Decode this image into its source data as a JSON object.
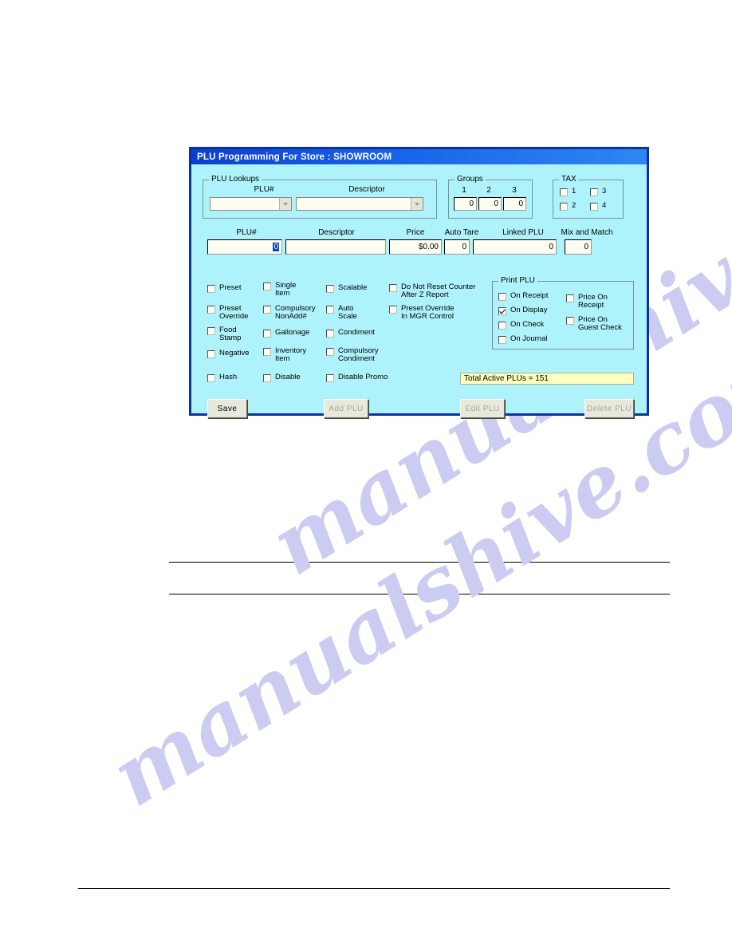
{
  "watermark": {
    "text": "manualshive.com"
  },
  "dialog": {
    "title": "PLU Programming For Store :  SHOWROOM",
    "lookups": {
      "group_title": "PLU Lookups",
      "plu_label": "PLU#",
      "plu_value": "",
      "descriptor_label": "Descriptor",
      "descriptor_value": ""
    },
    "groups": {
      "group_title": "Groups",
      "headers": [
        "1",
        "2",
        "3"
      ],
      "values": [
        "0",
        "0",
        "0"
      ]
    },
    "tax": {
      "group_title": "TAX",
      "items": [
        {
          "label": "1",
          "checked": false
        },
        {
          "label": "3",
          "checked": false
        },
        {
          "label": "2",
          "checked": false
        },
        {
          "label": "4",
          "checked": false
        }
      ]
    },
    "fields": {
      "plu_label": "PLU#",
      "plu_value": "0",
      "descriptor_label": "Descriptor",
      "descriptor_value": "",
      "price_label": "Price",
      "price_value": "$0.00",
      "auto_tare_label": "Auto Tare",
      "auto_tare_value": "0",
      "linked_plu_label": "Linked PLU",
      "linked_plu_value": "0",
      "mix_match_label": "Mix and Match",
      "mix_match_value": "0"
    },
    "options_col1": [
      {
        "label": "Preset",
        "checked": false
      },
      {
        "label": "Preset\nOverride",
        "checked": false
      },
      {
        "label": "Food\nStamp",
        "checked": false
      },
      {
        "label": "Negative",
        "checked": false
      },
      {
        "label": "Hash",
        "checked": false
      }
    ],
    "options_col2": [
      {
        "label": "Single\nItem",
        "checked": false
      },
      {
        "label": "Compulsory\nNonAdd#",
        "checked": false
      },
      {
        "label": "Gallonage",
        "checked": false
      },
      {
        "label": "Inventory\nItem",
        "checked": false
      },
      {
        "label": "Disable",
        "checked": false
      }
    ],
    "options_col3": [
      {
        "label": "Scalable",
        "checked": false
      },
      {
        "label": "Auto\nScale",
        "checked": false
      },
      {
        "label": "Condiment",
        "checked": false
      },
      {
        "label": "Compulsory\nCondiment",
        "checked": false
      },
      {
        "label": "Disable Promo",
        "checked": false
      }
    ],
    "options_col4": [
      {
        "label": "Do Not Reset Counter\nAfter Z Report",
        "checked": false
      },
      {
        "label": "Preset Override\nIn MGR Control",
        "checked": false
      }
    ],
    "print_plu": {
      "group_title": "Print PLU",
      "left_items": [
        {
          "label": "On Receipt",
          "checked": false
        },
        {
          "label": "On Display",
          "checked": true
        },
        {
          "label": "On Check",
          "checked": false
        },
        {
          "label": "On Journal",
          "checked": false
        }
      ],
      "right_items": [
        {
          "label": "Price On\nReceipt",
          "checked": false
        },
        {
          "label": "Price On\nGuest Check",
          "checked": false
        }
      ]
    },
    "status": {
      "text": "Total Active PLUs = 151"
    },
    "buttons": [
      {
        "label": "Save",
        "enabled": true
      },
      {
        "label": "Add PLU",
        "enabled": false
      },
      {
        "label": "Edit PLU",
        "enabled": false
      },
      {
        "label": "Delete PLU",
        "enabled": false
      }
    ]
  },
  "colors": {
    "dialog_bg": "#aef3fb",
    "dialog_border": "#0a32a0",
    "title_bar": "#1a63e8",
    "input_bg": "#fdfdf2",
    "status_bg": "#ffffc0",
    "button_face": "#e8e8dc",
    "watermark": "#ccccf2"
  }
}
